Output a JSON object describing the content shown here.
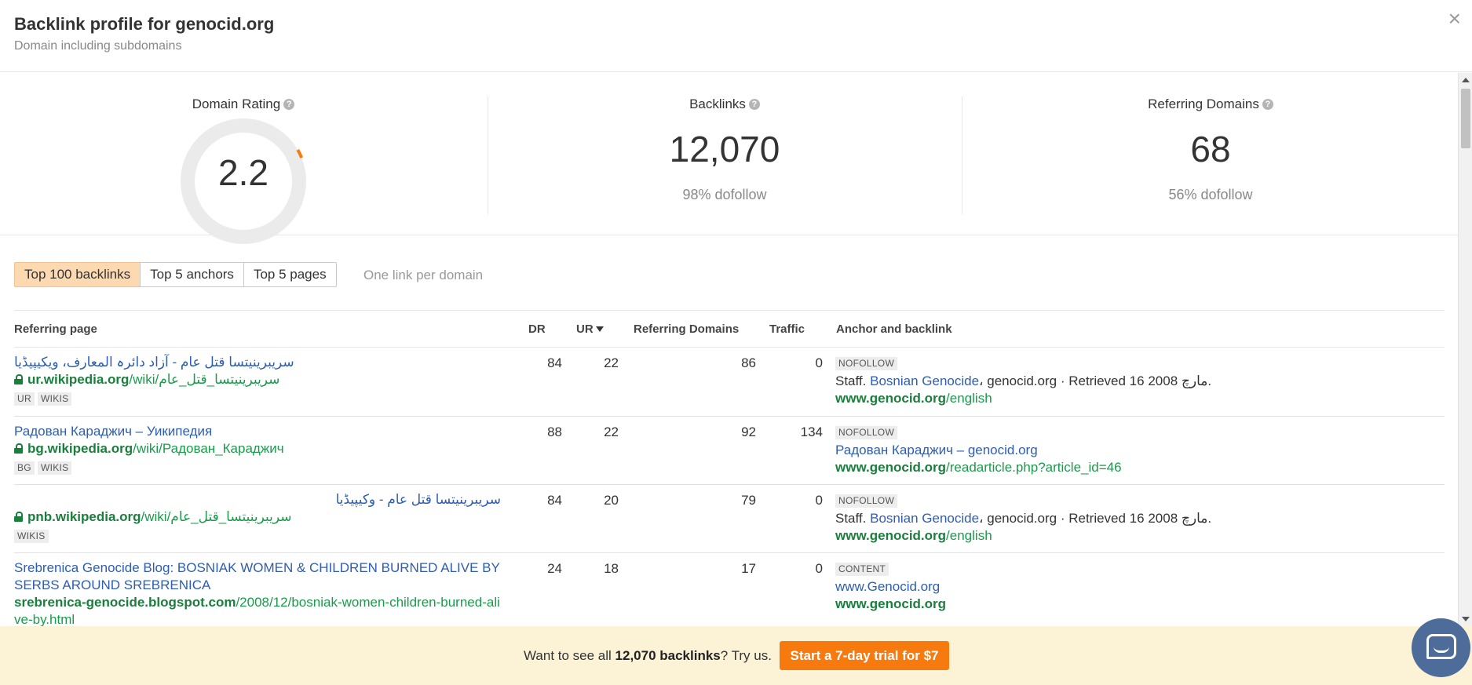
{
  "header": {
    "title": "Backlink profile for genocid.org",
    "subtitle": "Domain including subdomains",
    "close_icon": "×"
  },
  "stats": {
    "domain_rating": {
      "label": "Domain Rating",
      "value": "2.2",
      "gauge_fraction": 0.022,
      "help": "?"
    },
    "backlinks": {
      "label": "Backlinks",
      "value": "12,070",
      "sub": "98% dofollow",
      "help": "?"
    },
    "referring_domains": {
      "label": "Referring Domains",
      "value": "68",
      "sub": "56% dofollow",
      "help": "?"
    }
  },
  "tabs": [
    {
      "label": "Top 100 backlinks",
      "active": true
    },
    {
      "label": "Top 5 anchors",
      "active": false
    },
    {
      "label": "Top 5 pages",
      "active": false
    }
  ],
  "tab_note": "One link per domain",
  "table": {
    "columns": {
      "referring_page": "Referring page",
      "dr": "DR",
      "ur": "UR",
      "referring_domains": "Referring Domains",
      "traffic": "Traffic",
      "anchor": "Anchor and backlink"
    },
    "rows": [
      {
        "title": "سریبرینیتسا قتل عام - آزاد دائرہ المعارف، ویکیپیڈیا",
        "domain": "ur.wikipedia.org",
        "path": "/wiki/سریبرینیتسا_قتل_عام",
        "secure": true,
        "badges": [
          "UR",
          "WIKIS"
        ],
        "dr": "84",
        "ur": "22",
        "rd": "86",
        "traffic": "0",
        "tag": "NOFOLLOW",
        "anchor_pre": "Staff. ",
        "anchor_link": "Bosnian Genocide",
        "anchor_post": "، genocid.org · Retrieved 16 مارچ 2008.",
        "target_domain": "www.genocid.org",
        "target_path": "/english"
      },
      {
        "title": "Радован Караджич – Уикипедия",
        "domain": "bg.wikipedia.org",
        "path": "/wiki/Радован_Караджич",
        "secure": true,
        "badges": [
          "BG",
          "WIKIS"
        ],
        "dr": "88",
        "ur": "22",
        "rd": "92",
        "traffic": "134",
        "tag": "NOFOLLOW",
        "anchor_pre": "",
        "anchor_link": "Радован Караджич – genocid.org",
        "anchor_post": "",
        "target_domain": "www.genocid.org",
        "target_path": "/readarticle.php?article_id=46"
      },
      {
        "title": "سریبرینیتسا قتل عام - وکیپیڈیا",
        "domain": "pnb.wikipedia.org",
        "path": "/wiki/سریبرینیتسا_قتل_عام",
        "secure": true,
        "badges": [
          "WIKIS"
        ],
        "dr": "84",
        "ur": "20",
        "rd": "79",
        "traffic": "0",
        "tag": "NOFOLLOW",
        "anchor_pre": "Staff. ",
        "anchor_link": "Bosnian Genocide",
        "anchor_post": "، genocid.org · Retrieved 16 مارچ 2008.",
        "target_domain": "www.genocid.org",
        "target_path": "/english"
      },
      {
        "title": "Srebrenica Genocide Blog: BOSNIAK WOMEN & CHILDREN BURNED ALIVE BY SERBS AROUND SREBRENICA",
        "domain": "srebrenica-genocide.blogspot.com",
        "path": "/2008/12/bosniak-women-children-burned-alive-by.html",
        "secure": false,
        "badges": [],
        "dr": "24",
        "ur": "18",
        "rd": "17",
        "traffic": "0",
        "tag": "CONTENT",
        "anchor_pre": "",
        "anchor_link": "www.Genocid.org",
        "anchor_post": "",
        "target_domain": "www.genocid.org",
        "target_path": ""
      }
    ]
  },
  "footer": {
    "msg_pre": "Want to see all ",
    "msg_bold": "12,070 backlinks",
    "msg_post": "? Try us.",
    "cta": "Start a 7-day trial for $7"
  },
  "colors": {
    "accent": "#f77a0f",
    "active_tab": "#fcd9b1",
    "link": "#2e5db3",
    "url": "#1a7f3c",
    "footer_bg": "#fcf3d7",
    "gauge_track": "#ebebeb"
  }
}
